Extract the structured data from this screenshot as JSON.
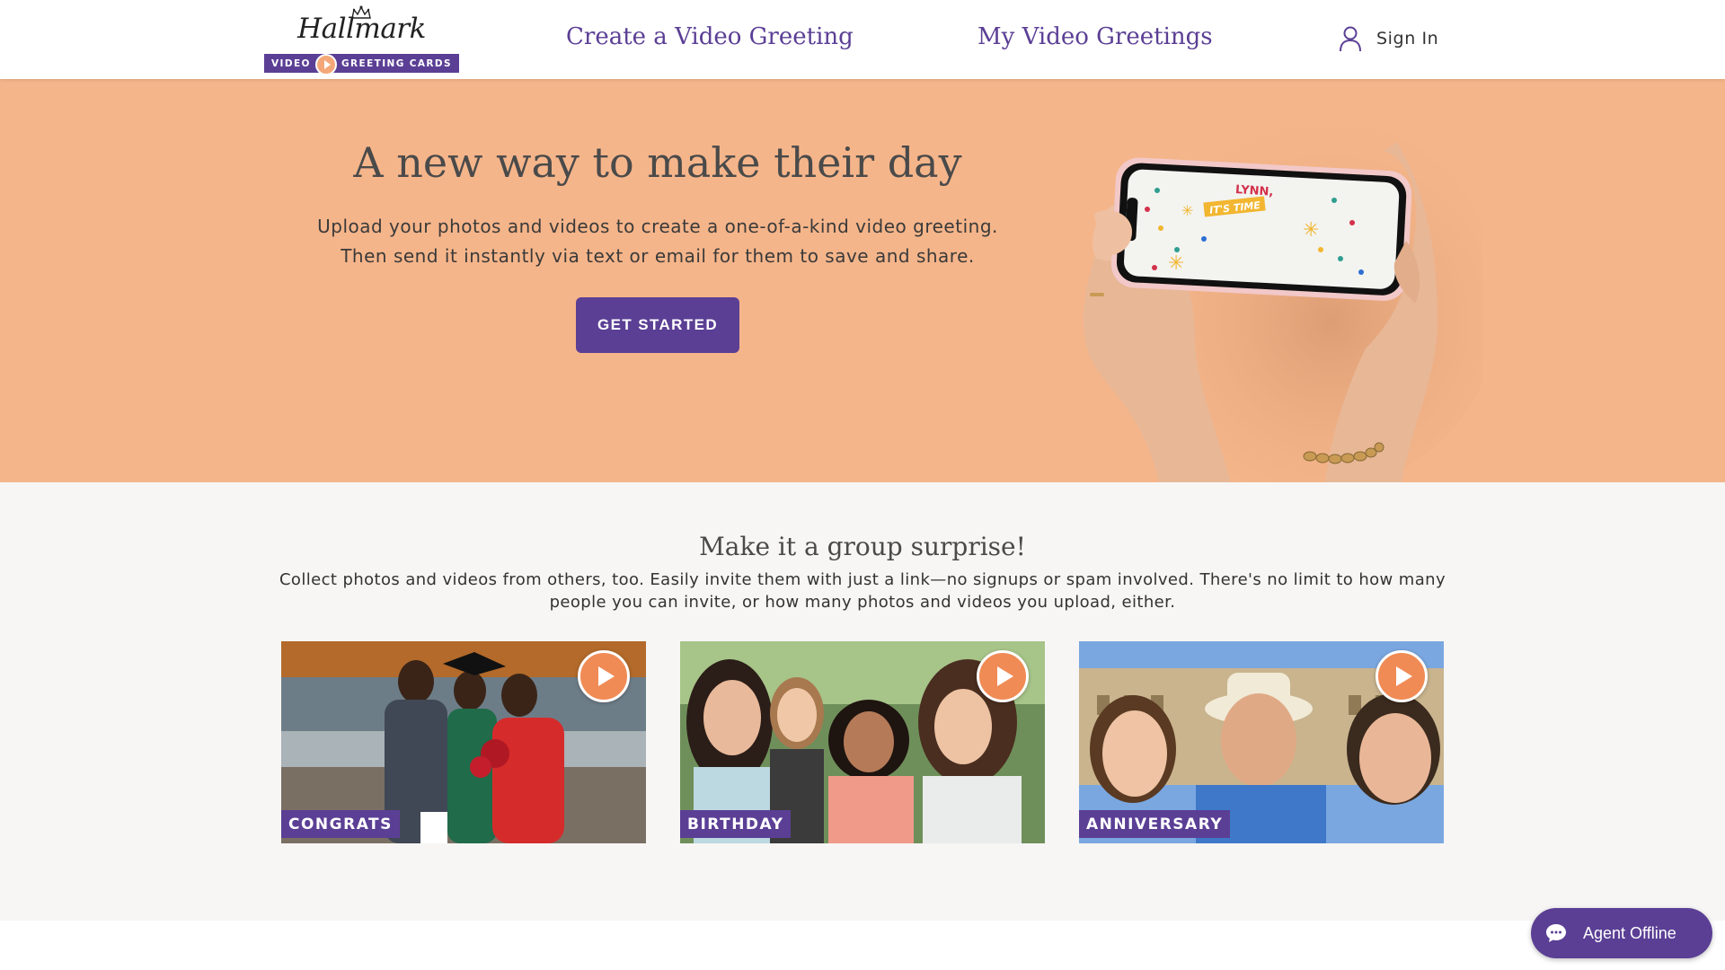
{
  "header": {
    "logo": {
      "script": "Hallmark",
      "bar_left": "VIDEO",
      "bar_right": "GREETING CARDS"
    },
    "nav": {
      "create_label": "Create a Video Greeting",
      "mine_label": "My Video Greetings"
    },
    "signin_label": "Sign In"
  },
  "hero": {
    "title": "A new way to make their day",
    "subtitle": "Upload your photos and videos to create a one-of-a-kind video greeting. Then send it instantly via text or email for them to save and share.",
    "cta_label": "GET STARTED",
    "phone_text_line1": "LYNN,",
    "phone_text_line2": "IT'S TIME"
  },
  "group": {
    "title": "Make it a group surprise!",
    "subtitle": "Collect photos and videos from others, too. Easily invite them with just a link—no signups or spam involved. There's no limit to how many people you can invite, or how many photos and videos you upload, either.",
    "cards": [
      {
        "tag": "CONGRATS"
      },
      {
        "tag": "BIRTHDAY"
      },
      {
        "tag": "ANNIVERSARY"
      }
    ]
  },
  "chat": {
    "label": "Agent Offline"
  },
  "colors": {
    "brand_purple": "#5b3f95",
    "hero_peach": "#f5b58a",
    "play_orange": "#f08b55",
    "section_bg": "#f7f6f4"
  },
  "icons": [
    "crown-icon",
    "play-icon",
    "user-icon",
    "chat-bubble-icon"
  ]
}
